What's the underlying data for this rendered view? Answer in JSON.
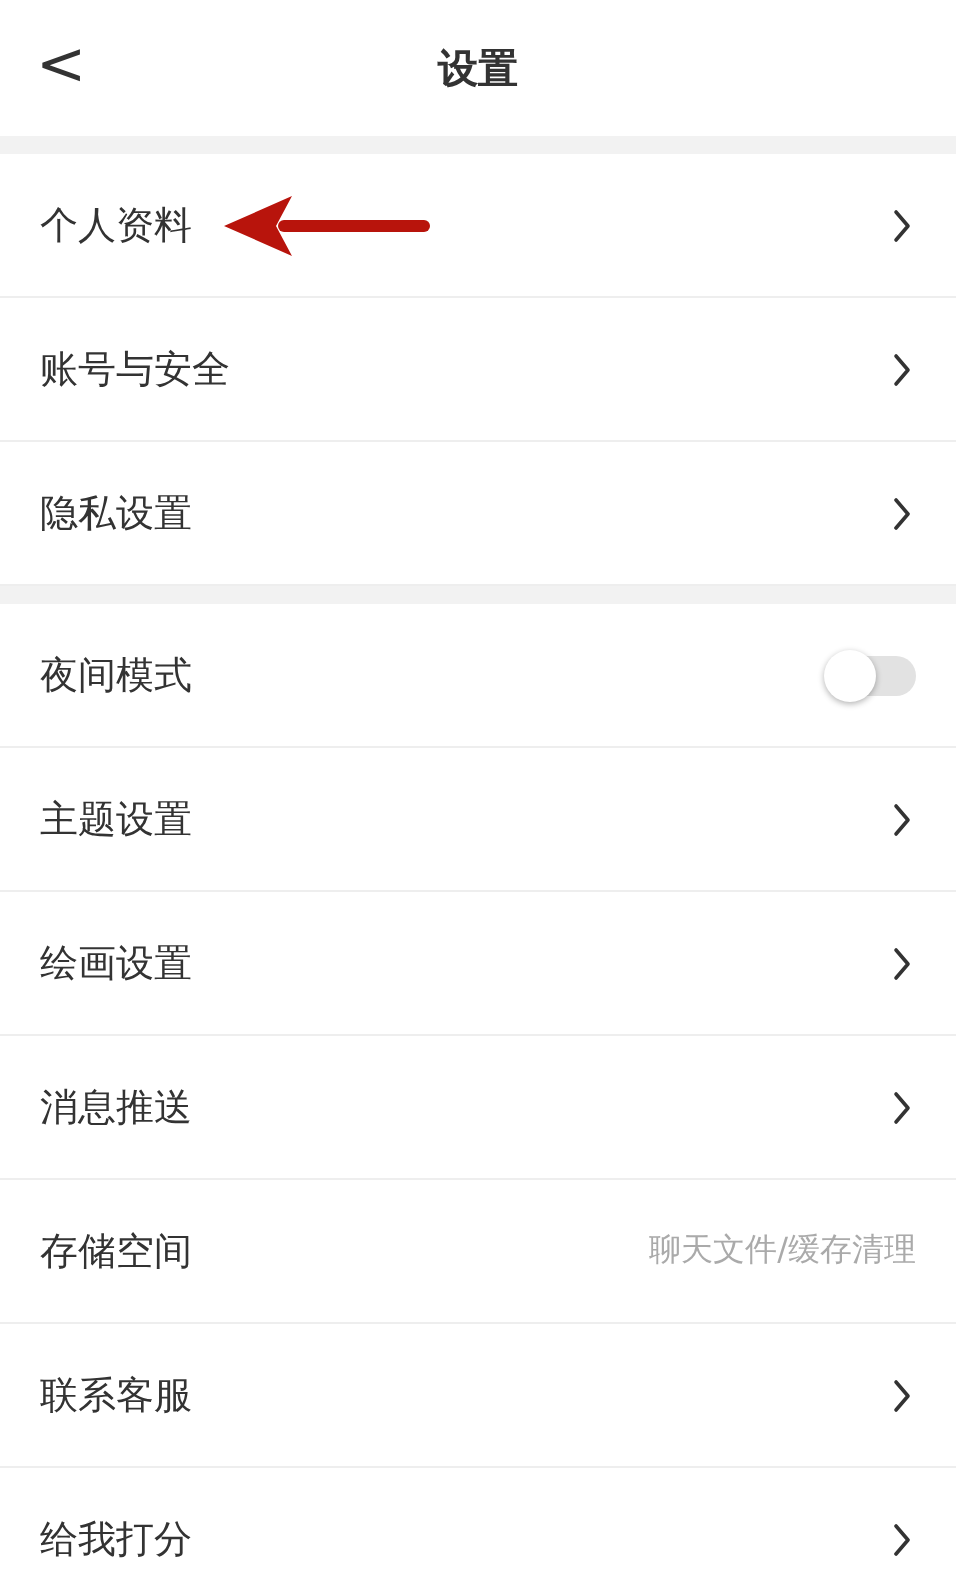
{
  "header": {
    "back": "<",
    "title": "设置"
  },
  "groups": [
    {
      "items": [
        {
          "kind": "link",
          "label": "个人资料",
          "annotated": true
        },
        {
          "kind": "link",
          "label": "账号与安全",
          "annotated": false
        },
        {
          "kind": "link",
          "label": "隐私设置",
          "annotated": false
        }
      ]
    },
    {
      "items": [
        {
          "kind": "toggle",
          "label": "夜间模式",
          "on": false
        },
        {
          "kind": "link",
          "label": "主题设置",
          "annotated": false
        },
        {
          "kind": "link",
          "label": "绘画设置",
          "annotated": false
        },
        {
          "kind": "link",
          "label": "消息推送",
          "annotated": false
        },
        {
          "kind": "value",
          "label": "存储空间",
          "value": "聊天文件/缓存清理"
        },
        {
          "kind": "link",
          "label": "联系客服",
          "annotated": false
        },
        {
          "kind": "link",
          "label": "给我打分",
          "annotated": false
        }
      ]
    }
  ]
}
